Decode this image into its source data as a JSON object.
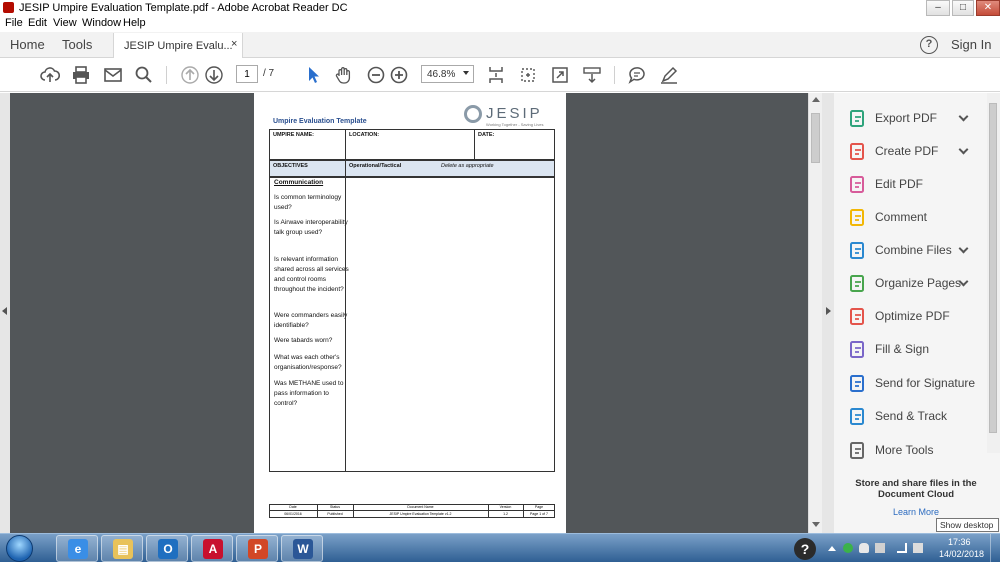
{
  "window": {
    "title": "JESIP Umpire Evaluation Template.pdf - Adobe Acrobat Reader DC",
    "min": "–",
    "max": "□",
    "close": "✕"
  },
  "menu": [
    "File",
    "Edit",
    "View",
    "Window",
    "Help"
  ],
  "nav": {
    "home": "Home",
    "tools": "Tools",
    "tab_label": "JESIP Umpire Evalu...",
    "tab_close": "×",
    "help": "?",
    "sign_in": "Sign In"
  },
  "toolbar": {
    "page_current": "1",
    "page_total": "/ 7",
    "zoom": "46.8%"
  },
  "document": {
    "heading": "Umpire Evaluation Template",
    "logo_text": "JESIP",
    "logo_tagline": "Working Together - Saving Lives",
    "umpire_name": "UMPIRE NAME:",
    "location": "LOCATION:",
    "date": "DATE:",
    "objectives": "OBJECTIVES",
    "operational": "Operational/Tactical",
    "delete_note": "Delete as appropriate",
    "section_title": "Communication",
    "questions": [
      "Is common terminology used?",
      "Is Airwave interoperability talk group used?",
      "Is relevant information shared across all services and control rooms throughout the incident?",
      "Were commanders easily identifiable?",
      "Were tabards worn?",
      "What was each other's organisation/response?",
      "Was METHANE used to pass information to control?"
    ],
    "footer_headers": [
      "Date",
      "Status",
      "Document Name",
      "Version",
      "Page"
    ],
    "footer_values": [
      "06/01/2016",
      "Published",
      "JESIP Umpire Evaluation Template v1.2",
      "1.2",
      "Page 1 of 7"
    ]
  },
  "tools_panel": {
    "items": [
      {
        "label": "Export PDF",
        "icon": "export-pdf-icon",
        "color": "#2ea37b",
        "chevron": true
      },
      {
        "label": "Create PDF",
        "icon": "create-pdf-icon",
        "color": "#e4544b",
        "chevron": true
      },
      {
        "label": "Edit PDF",
        "icon": "edit-pdf-icon",
        "color": "#d75b9a",
        "chevron": false
      },
      {
        "label": "Comment",
        "icon": "comment-icon",
        "color": "#f2b705",
        "chevron": false
      },
      {
        "label": "Combine Files",
        "icon": "combine-files-icon",
        "color": "#2a88d0",
        "chevron": true
      },
      {
        "label": "Organize Pages",
        "icon": "organize-pages-icon",
        "color": "#48a54d",
        "chevron": true
      },
      {
        "label": "Optimize PDF",
        "icon": "optimize-pdf-icon",
        "color": "#e4544b",
        "chevron": false
      },
      {
        "label": "Fill & Sign",
        "icon": "fill-sign-icon",
        "color": "#7a66c8",
        "chevron": false
      },
      {
        "label": "Send for Signature",
        "icon": "send-signature-icon",
        "color": "#2a6fcd",
        "chevron": false
      },
      {
        "label": "Send & Track",
        "icon": "send-track-icon",
        "color": "#2a88d0",
        "chevron": false
      },
      {
        "label": "More Tools",
        "icon": "more-tools-icon",
        "color": "#666666",
        "chevron": false
      }
    ],
    "promo": "Store and share files in the Document Cloud",
    "learn_more": "Learn More"
  },
  "tooltip": "Show desktop",
  "taskbar": {
    "apps": [
      {
        "name": "ie",
        "glyph": "e",
        "color": "#3a8ee6"
      },
      {
        "name": "explorer",
        "glyph": "▤",
        "color": "#e8c25a"
      },
      {
        "name": "outlook",
        "glyph": "O",
        "color": "#1f6fc0"
      },
      {
        "name": "acrobat",
        "glyph": "A",
        "color": "#c8102e"
      },
      {
        "name": "powerpoint",
        "glyph": "P",
        "color": "#d24726"
      },
      {
        "name": "word",
        "glyph": "W",
        "color": "#2b5797"
      }
    ],
    "help": "?",
    "time": "17:36",
    "date": "14/02/2018"
  }
}
